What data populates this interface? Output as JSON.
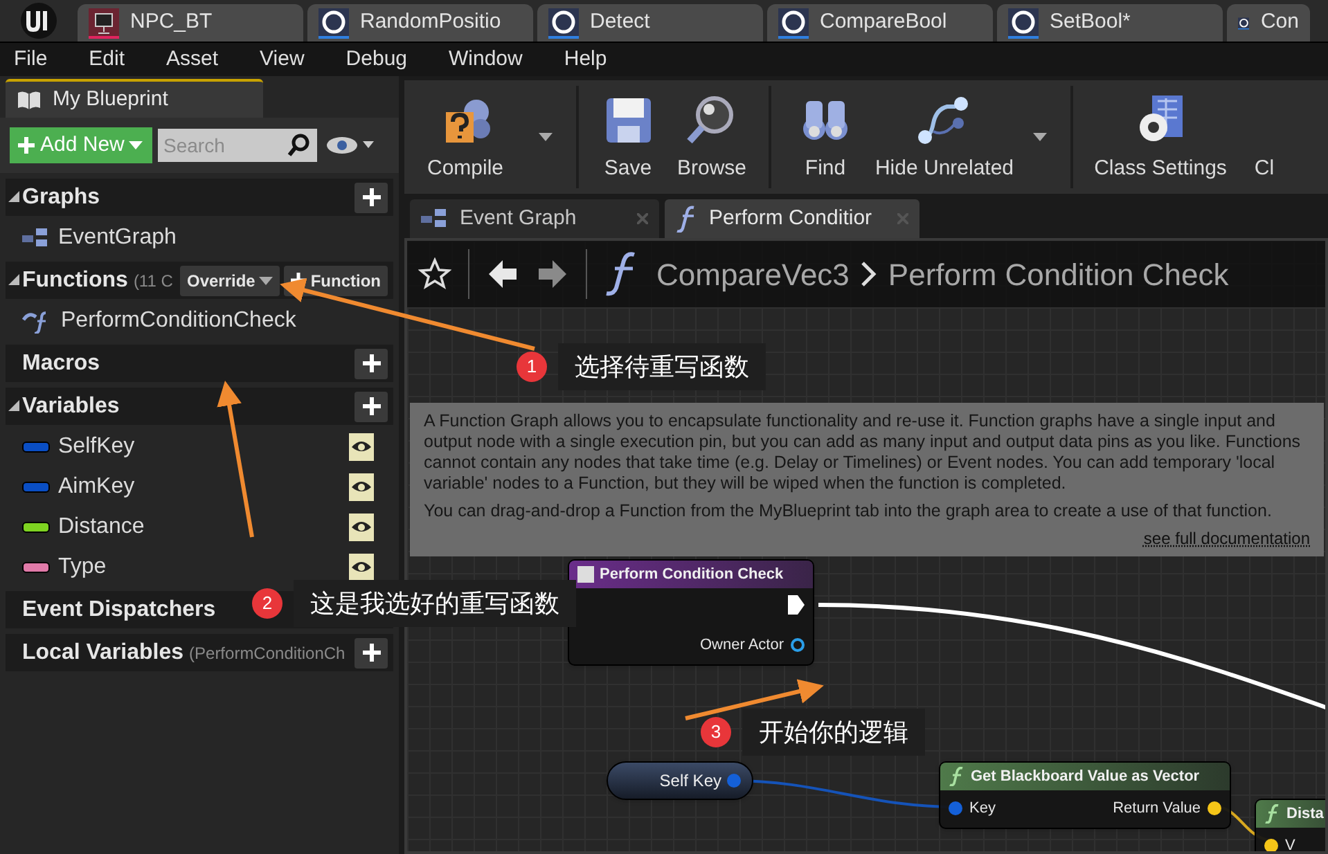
{
  "app_tabs": [
    {
      "label": "NPC_BT",
      "kind": "behavior_tree"
    },
    {
      "label": "RandomPositio",
      "kind": "task"
    },
    {
      "label": "Detect",
      "kind": "task"
    },
    {
      "label": "CompareBool",
      "kind": "task"
    },
    {
      "label": "SetBool*",
      "kind": "task"
    },
    {
      "label": "Con",
      "kind": "task"
    }
  ],
  "menu": [
    "File",
    "Edit",
    "Asset",
    "View",
    "Debug",
    "Window",
    "Help"
  ],
  "my_blueprint": {
    "tab": "My Blueprint",
    "add_new": "Add New",
    "search_placeholder": "Search",
    "sections": [
      {
        "title": "Graphs",
        "expanded": true,
        "add_button": true,
        "items": [
          {
            "label": "EventGraph",
            "kind": "graph"
          }
        ]
      },
      {
        "title": "Functions",
        "expanded": true,
        "add_button": false,
        "note": "(11 C",
        "buttons": [
          "Override",
          "Function"
        ],
        "items": [
          {
            "label": "PerformConditionCheck",
            "kind": "function"
          }
        ]
      },
      {
        "title": "Macros",
        "expanded": false,
        "add_button": true
      },
      {
        "title": "Variables",
        "expanded": true,
        "add_button": true,
        "items": [
          {
            "label": "SelfKey",
            "kind": "variable",
            "color": "#0a4ec4"
          },
          {
            "label": "AimKey",
            "kind": "variable",
            "color": "#0a4ec4"
          },
          {
            "label": "Distance",
            "kind": "variable",
            "color": "#7ed321"
          },
          {
            "label": "Type",
            "kind": "variable",
            "color": "#e07aa8"
          }
        ]
      },
      {
        "title": "Event Dispatchers",
        "expanded": false,
        "add_button": false
      },
      {
        "title": "Local Variables",
        "expanded": false,
        "add_button": true,
        "note": "(PerformConditionCh"
      }
    ]
  },
  "toolbar": [
    {
      "label": "Compile",
      "kind": "compile",
      "dropdown": true,
      "separator_after": true
    },
    {
      "label": "Save",
      "kind": "save",
      "dropdown": false,
      "separator_after": false
    },
    {
      "label": "Browse",
      "kind": "browse",
      "dropdown": false,
      "separator_after": true
    },
    {
      "label": "Find",
      "kind": "find",
      "dropdown": false,
      "separator_after": false
    },
    {
      "label": "Hide Unrelated",
      "kind": "hide_unrelated",
      "dropdown": true,
      "separator_after": true
    },
    {
      "label": "Class Settings",
      "kind": "class_settings",
      "dropdown": false,
      "separator_after": false
    },
    {
      "label": "Cl",
      "kind": "cut",
      "dropdown": false,
      "separator_after": false
    }
  ],
  "graph_tabs": [
    {
      "label": "Event Graph",
      "kind": "graph",
      "selected": false
    },
    {
      "label": "Perform Conditior",
      "kind": "function",
      "selected": true
    }
  ],
  "breadcrumb": [
    "CompareVec3",
    "Perform Condition Check"
  ],
  "tooltip": {
    "paragraphs": [
      "A Function Graph allows you to encapsulate functionality and re-use it. Function graphs have a single input and output node with a single execution pin, but you can add as many input and output data pins as you like. Functions cannot contain any nodes that take time (e.g. Delay or Timelines) or Event nodes. You can add temporary 'local variable' nodes to a Function, but they will be wiped when the function is completed.",
      "You can drag-and-drop a Function from the MyBlueprint tab into the graph area to create a use of that function."
    ],
    "link": "see full documentation"
  },
  "nodes": [
    {
      "kind": "entry",
      "title": "Perform Condition Check",
      "pins": [
        {
          "label": "Owner Actor",
          "kind": "output",
          "color": "#2a9ee8"
        }
      ]
    },
    {
      "kind": "variable",
      "title": "Self Key"
    },
    {
      "kind": "function",
      "title": "Get Blackboard Value as Vector",
      "pins": [
        {
          "label": "Key",
          "kind": "input",
          "color": "#1460d8"
        },
        {
          "label": "Return Value",
          "kind": "output",
          "color": "#f5c518"
        }
      ]
    },
    {
      "kind": "function",
      "title": "Dista",
      "pins": [
        {
          "label": "V",
          "kind": "input",
          "color": "#f5c518"
        }
      ]
    }
  ],
  "callouts": [
    {
      "number": "1",
      "text": "选择待重写函数"
    },
    {
      "number": "2",
      "text": "这是我选好的重写函数"
    },
    {
      "number": "3",
      "text": "开始你的逻辑"
    }
  ]
}
